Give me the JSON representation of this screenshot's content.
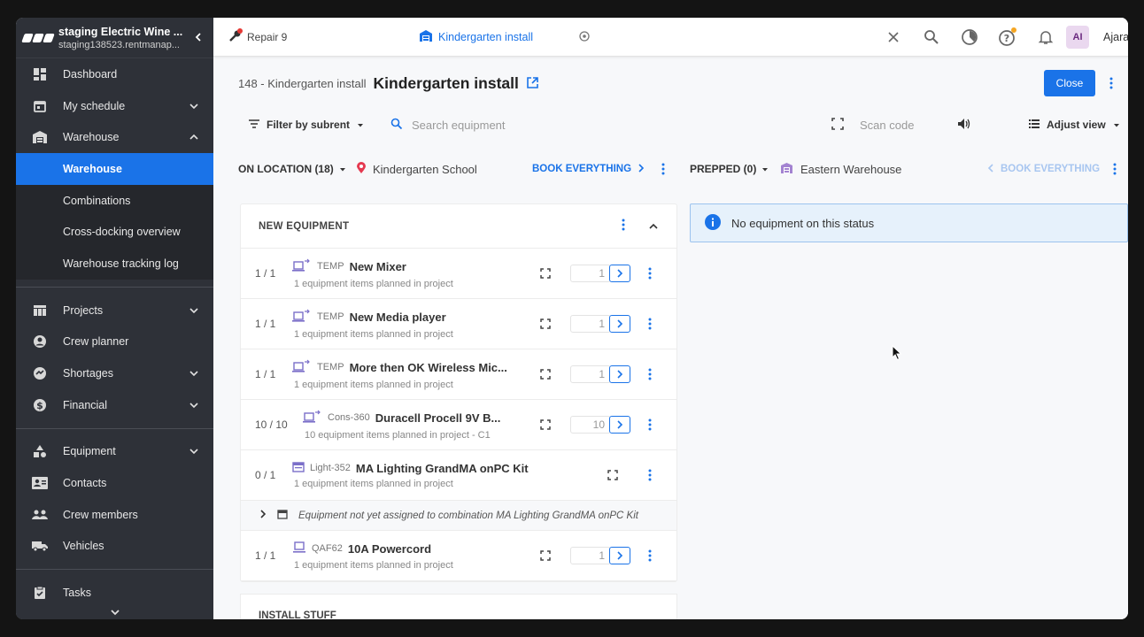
{
  "sidebar": {
    "org_title": "staging Electric Wine ...",
    "org_sub": "staging138523.rentmanap...",
    "items": [
      {
        "label": "Dashboard"
      },
      {
        "label": "My schedule"
      },
      {
        "label": "Warehouse"
      },
      {
        "label": "Projects"
      },
      {
        "label": "Crew planner"
      },
      {
        "label": "Shortages"
      },
      {
        "label": "Financial"
      },
      {
        "label": "Equipment"
      },
      {
        "label": "Contacts"
      },
      {
        "label": "Crew members"
      },
      {
        "label": "Vehicles"
      },
      {
        "label": "Tasks"
      }
    ],
    "warehouse_sub": [
      "Warehouse",
      "Combinations",
      "Cross-docking overview",
      "Warehouse tracking log"
    ]
  },
  "topbar": {
    "repair_label": "Repair 9",
    "active_tab": "Kindergarten install",
    "avatar_initials": "AI",
    "user_name": "Ajara"
  },
  "header": {
    "crumb": "148 - Kindergarten install",
    "title": "Kindergarten install",
    "close_label": "Close"
  },
  "toolbar": {
    "filter_label": "Filter by subrent",
    "search_placeholder": "Search equipment",
    "scan_placeholder": "Scan code",
    "adjust_label": "Adjust view"
  },
  "left_status": {
    "label": "ON LOCATION (18)",
    "location": "Kindergarten School",
    "book": "BOOK EVERYTHING"
  },
  "right_status": {
    "label": "PREPPED (0)",
    "location": "Eastern Warehouse",
    "book": "BOOK EVERYTHING"
  },
  "panel": {
    "title": "NEW EQUIPMENT",
    "rows": [
      {
        "count": "1 / 1",
        "code": "TEMP",
        "name": "New Mixer",
        "sub": "1 equipment items planned in project",
        "qty": "1"
      },
      {
        "count": "1 / 1",
        "code": "TEMP",
        "name": "New Media player",
        "sub": "1 equipment items planned in project",
        "qty": "1"
      },
      {
        "count": "1 / 1",
        "code": "TEMP",
        "name": "More then OK Wireless Mic...",
        "sub": "1 equipment items planned in project",
        "qty": "1"
      },
      {
        "count": "10 / 10",
        "code": "Cons-360",
        "name": "Duracell Procell 9V B...",
        "sub": "10 equipment items planned in project - C1",
        "qty": "10"
      },
      {
        "count": "0 / 1",
        "code": "Light-352",
        "name": "MA Lighting GrandMA onPC Kit",
        "sub": "1 equipment items planned in project"
      },
      {
        "count": "1 / 1",
        "code": "QAF62",
        "name": "10A Powercord",
        "sub": "1 equipment items planned in project",
        "qty": "1"
      }
    ],
    "combo_note": "Equipment not yet assigned to combination MA Lighting GrandMA onPC Kit"
  },
  "panel2_title": "INSTALL STUFF",
  "notice": "No equipment on this status",
  "colors": {
    "accent": "#1a73e8",
    "sidebar": "#2e3138",
    "notice_bg": "#e6f1fb"
  }
}
